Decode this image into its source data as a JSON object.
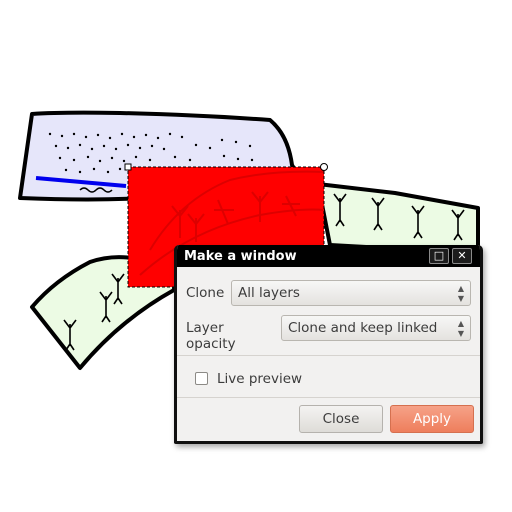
{
  "dialog": {
    "title": "Make a window",
    "maximize_icon": "maximize-icon",
    "close_icon": "close-icon",
    "clone_label": "Clone",
    "clone_value": "All layers",
    "opacity_label": "Layer opacity",
    "opacity_value": "Clone and keep linked",
    "live_preview_label": "Live preview",
    "live_preview_checked": false,
    "close_button": "Close",
    "apply_button": "Apply"
  },
  "colors": {
    "selection_fill": "#ff0000",
    "top_band": "#e6e6fa",
    "lower_band": "#ecfbe4",
    "river_line": "#0000ee",
    "apply_accent": "#ee7e5c"
  }
}
